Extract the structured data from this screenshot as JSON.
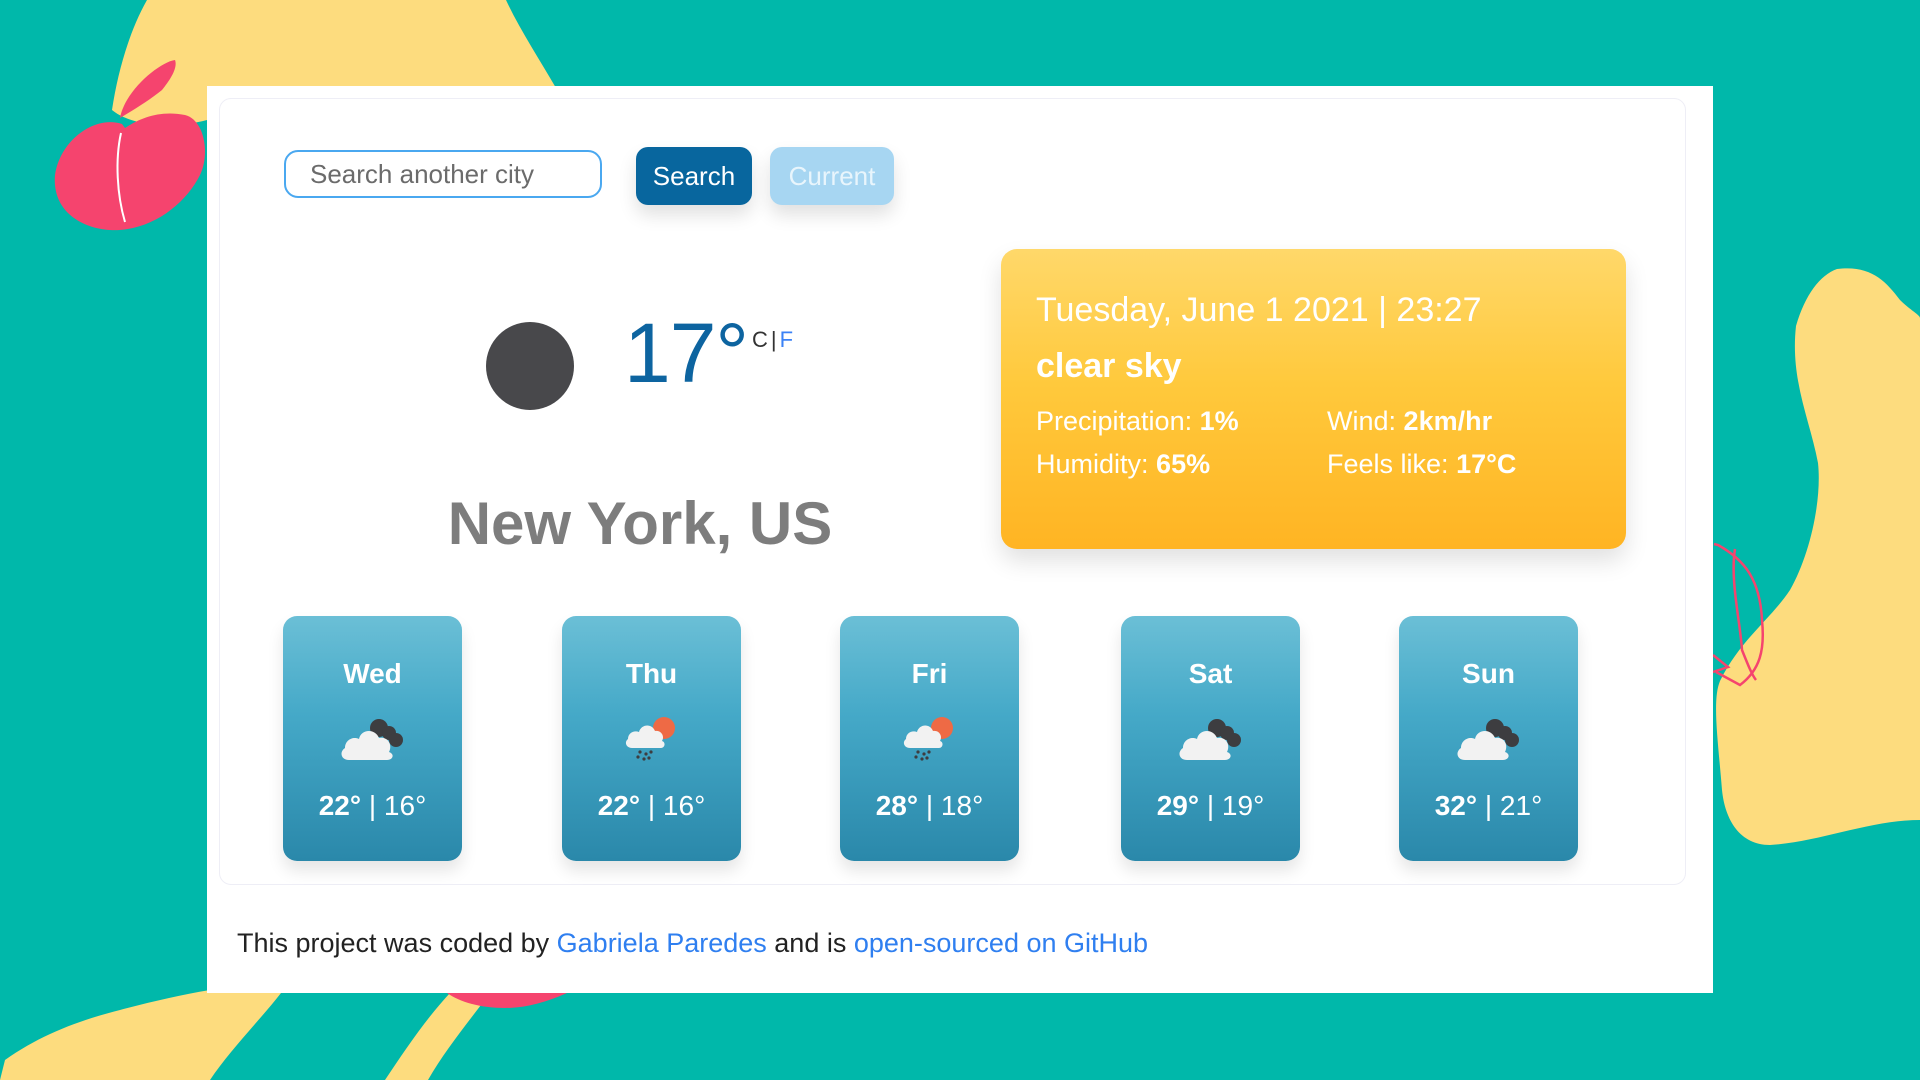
{
  "colors": {
    "background": "#00b8aa",
    "blob": "#fddc7e",
    "apple": "#f5446e",
    "search_button": "#08669e",
    "current_button": "#a7d6f2",
    "temperature": "#0d64a0",
    "link": "#2f7ff0"
  },
  "search": {
    "placeholder": "Search another city",
    "value": "",
    "search_label": "Search",
    "current_label": "Current"
  },
  "current": {
    "icon": "moon-icon",
    "temperature": "17°",
    "unit_c": "C",
    "unit_separator": "|",
    "unit_f": "F",
    "city": "New York, US"
  },
  "details": {
    "date": "Tuesday, June 1 2021 | 23:27",
    "description": "clear sky",
    "precipitation_label": "Precipitation:",
    "precipitation_value": "1%",
    "humidity_label": "Humidity:",
    "humidity_value": "65%",
    "wind_label": "Wind:",
    "wind_value": "2km/hr",
    "feels_like_label": "Feels like:",
    "feels_like_value": "17°C"
  },
  "forecast": [
    {
      "day": "Wed",
      "icon": "cloudy-icon",
      "max": "22°",
      "sep": "|",
      "min": "16°"
    },
    {
      "day": "Thu",
      "icon": "rain-sun-icon",
      "max": "22°",
      "sep": "|",
      "min": "16°"
    },
    {
      "day": "Fri",
      "icon": "rain-sun-icon",
      "max": "28°",
      "sep": "|",
      "min": "18°"
    },
    {
      "day": "Sat",
      "icon": "cloudy-icon",
      "max": "29°",
      "sep": "|",
      "min": "19°"
    },
    {
      "day": "Sun",
      "icon": "cloudy-icon",
      "max": "32°",
      "sep": "|",
      "min": "21°"
    }
  ],
  "footer": {
    "text_1": "This project was coded by ",
    "author_link": "Gabriela Paredes",
    "text_2": " and is ",
    "repo_link": "open-sourced on GitHub"
  }
}
